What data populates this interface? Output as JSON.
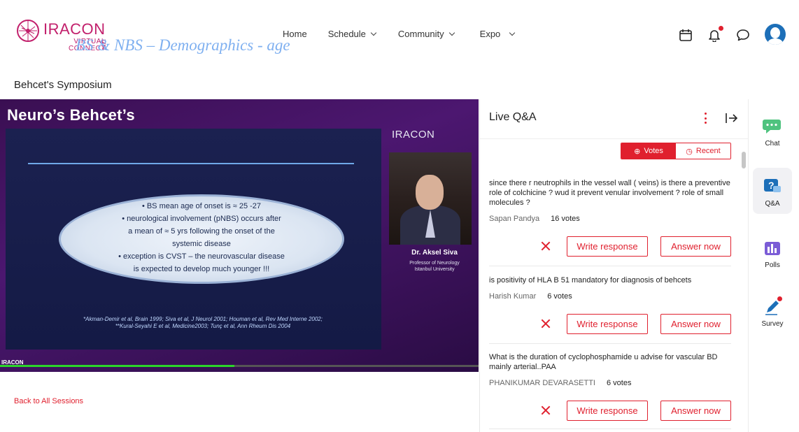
{
  "brand": {
    "name": "IRACON",
    "sub_line1": "VIRTUAL",
    "sub_line2": "CONNECT",
    "year": "2021",
    "color": "#c2206c"
  },
  "nav": {
    "home": "Home",
    "schedule": "Schedule",
    "community": "Community",
    "expo": "Expo"
  },
  "top_icons": [
    "calendar-icon",
    "bell-icon",
    "chat-bubble-icon",
    "avatar"
  ],
  "session": {
    "title": "Behcet's Symposium",
    "back_link": "Back to All Sessions"
  },
  "video": {
    "headline": "Neuro’s Behcet’s",
    "slide_title": "BS & NBS – Demographics - age",
    "bullets": [
      "• BS mean age of onset is ≈ 25 -27",
      "• neurological involvement (pNBS) occurs after",
      "a mean of ≈ 5 yrs following the onset of the",
      "systemic disease",
      "• exception is CVST – the neurovascular disease",
      "is expected to develop much younger !!!"
    ],
    "references": [
      "*Akman-Demir et al, Brain 1999; Siva et al, J Neurol 2001; Houman et al, Rev Med Interne 2002;",
      "**Kural-Seyahi E et al, Medicine2003; Tunç et al, Ann Rheum Dis 2004"
    ],
    "overlay_logo": "IRACON",
    "speaker_name": "Dr. Aksel Siva",
    "speaker_role_1": "Professor of Neurology",
    "speaker_role_2": "Istanbul University",
    "corner_mark": "IRACON",
    "progress": 0.49,
    "progress_color": "#2bd52b"
  },
  "qa": {
    "title": "Live Q&A",
    "toggle_votes": "Votes",
    "toggle_recent": "Recent",
    "accent": "#e0202e",
    "write_label": "Write response",
    "answer_label": "Answer now",
    "questions": [
      {
        "text": "since there r neutrophils in the vessel wall ( veins) is there a preventive role of colchicine ? wud it prevent venular involvement ? role of small molecules ?",
        "author": "Sapan Pandya",
        "votes": "16 votes"
      },
      {
        "text": "is positivity of HLA B 51 mandatory for diagnosis of behcets",
        "author": "Harish Kumar",
        "votes": "6 votes"
      },
      {
        "text": "What is the duration of cyclophosphamide u advise for vascular BD mainly arterial..PAA",
        "author": "PHANIKUMAR DEVARASETTI",
        "votes": "6 votes"
      }
    ]
  },
  "rail": {
    "chat": "Chat",
    "qa": "Q&A",
    "polls": "Polls",
    "survey": "Survey"
  }
}
